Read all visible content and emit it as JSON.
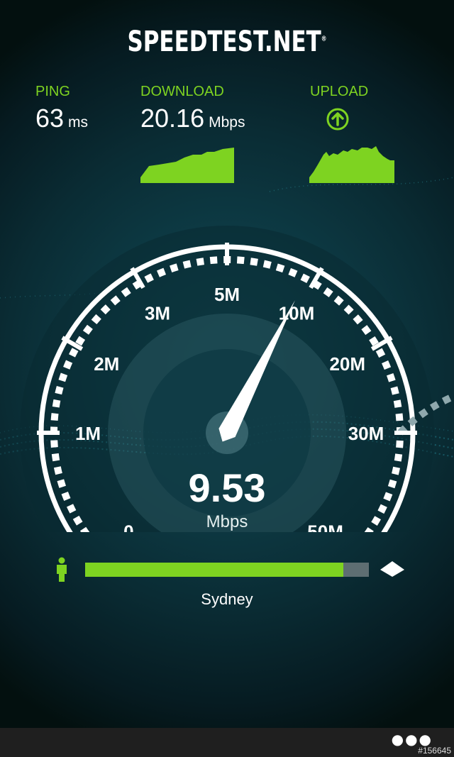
{
  "app": {
    "logo_text": "SPEEDTEST.NET",
    "logo_mark": "®"
  },
  "stats": {
    "ping": {
      "label": "PING",
      "value": "63",
      "unit": "ms"
    },
    "download": {
      "label": "DOWNLOAD",
      "value": "20.16",
      "unit": "Mbps"
    },
    "upload": {
      "label": "UPLOAD",
      "icon": "upload-arrow-icon"
    }
  },
  "gauge": {
    "tick_labels": [
      "0",
      "1M",
      "2M",
      "3M",
      "5M",
      "10M",
      "20M",
      "30M",
      "50M"
    ],
    "current_value": 9.53,
    "reading": "9.53",
    "unit": "Mbps"
  },
  "progress": {
    "fraction": 0.91,
    "server": "Sydney",
    "icons": {
      "client": "person-icon",
      "server": "server-icon"
    }
  },
  "appbar": {
    "more": "●●●"
  },
  "watermark": "#156645",
  "colors": {
    "accent": "#7ed321",
    "background": "#0d3a44",
    "text": "#ffffff"
  }
}
